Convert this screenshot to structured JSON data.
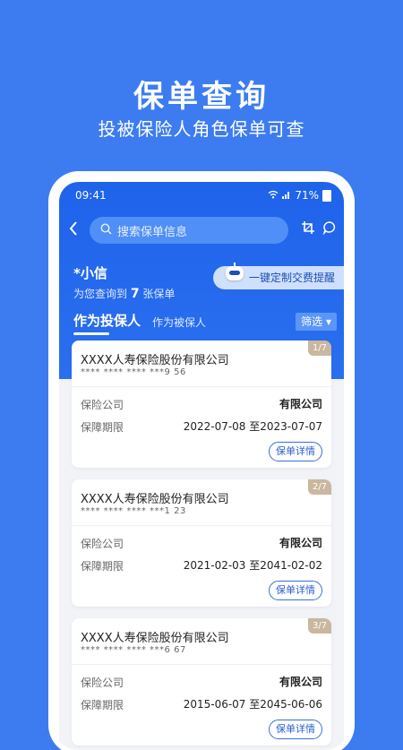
{
  "promo": {
    "title": "保单查询",
    "subtitle": "投被保险人角色保单可查"
  },
  "status_bar": {
    "time": "09:41",
    "battery": "71%"
  },
  "search": {
    "placeholder": "搜索保单信息"
  },
  "user": {
    "name": "*小信",
    "count_prefix": "为您查询到",
    "count": "7",
    "count_suffix": "张保单"
  },
  "reminder": {
    "label": "一键定制交费提醒"
  },
  "tabs": {
    "active": "作为投保人",
    "other": "作为被保人",
    "filter": "筛选"
  },
  "colors": {
    "brand_blue": "#3d7cf0",
    "header_blue": "#1e63ea",
    "badge": "#c9b79f"
  },
  "policies": [
    {
      "company": "XXXX人寿保险股份有限公司",
      "policy_no": "**** **** **** ***9 56",
      "badge": "1/7",
      "insurer_label": "保险公司",
      "insurer_value": "有限公司",
      "period_label": "保障期限",
      "period_value": "2022-07-08 至2023-07-07",
      "detail_button": "保单详情"
    },
    {
      "company": "XXXX人寿保险股份有限公司",
      "policy_no": "**** **** **** ***1 23",
      "badge": "2/7",
      "insurer_label": "保险公司",
      "insurer_value": "有限公司",
      "period_label": "保障期限",
      "period_value": "2021-02-03 至2041-02-02",
      "detail_button": "保单详情"
    },
    {
      "company": "XXXX人寿保险股份有限公司",
      "policy_no": "**** **** **** ***6 67",
      "badge": "3/7",
      "insurer_label": "保险公司",
      "insurer_value": "有限公司",
      "period_label": "保障期限",
      "period_value": "2015-06-07 至2045-06-06",
      "detail_button": "保单详情"
    }
  ]
}
